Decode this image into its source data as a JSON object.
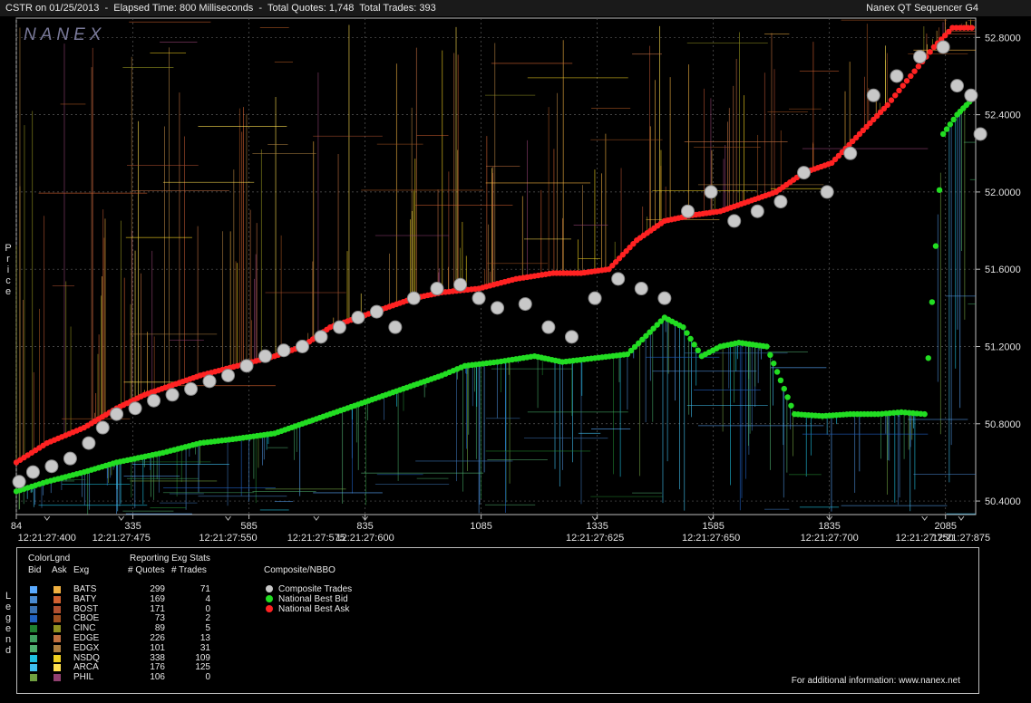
{
  "header": {
    "left": "CSTR on 01/25/2013  -  Elapsed Time: 800 Milliseconds  -  Total Quotes: 1,748  Total Trades: 393",
    "right": "Nanex QT Sequencer G4"
  },
  "logo": "NANEX",
  "axis": {
    "ylabel": "Price",
    "legend_side": "Legend"
  },
  "chart_data": {
    "type": "scatter",
    "title": "",
    "ylabel": "Price",
    "ylim": [
      50.33,
      52.9
    ],
    "xlim": [
      84,
      2150
    ],
    "y_ticks": [
      "52.8000",
      "52.4000",
      "52.0000",
      "51.6000",
      "51.2000",
      "50.8000",
      "50.4000"
    ],
    "y_tick_values": [
      52.8,
      52.4,
      52.0,
      51.6,
      51.2,
      50.8,
      50.4
    ],
    "x_ticks": [
      "84",
      "335",
      "585",
      "835",
      "1085",
      "1335",
      "1585",
      "1835",
      "2085"
    ],
    "x_tick_values": [
      84,
      335,
      585,
      835,
      1085,
      1335,
      1585,
      1835,
      2085
    ],
    "time_labels": [
      "12:21:27:400",
      "12:21:27:475",
      "12:21:27:550",
      "12:21:27:575",
      "12:21:27:600",
      "12:21:27:625",
      "12:21:27:650",
      "12:21:27:700",
      "12:21:27:750",
      "12:21:27:875"
    ],
    "time_label_values": [
      150,
      310,
      540,
      730,
      835,
      1330,
      1580,
      1835,
      2040,
      2180
    ],
    "series": [
      {
        "name": "National Best Bid",
        "color": "#22dd22",
        "points": [
          [
            84,
            50.45
          ],
          [
            150,
            50.5
          ],
          [
            230,
            50.55
          ],
          [
            300,
            50.6
          ],
          [
            400,
            50.65
          ],
          [
            480,
            50.7
          ],
          [
            550,
            50.72
          ],
          [
            640,
            50.75
          ],
          [
            700,
            50.8
          ],
          [
            760,
            50.85
          ],
          [
            820,
            50.9
          ],
          [
            880,
            50.95
          ],
          [
            940,
            51.0
          ],
          [
            1000,
            51.05
          ],
          [
            1050,
            51.1
          ],
          [
            1120,
            51.12
          ],
          [
            1200,
            51.15
          ],
          [
            1260,
            51.12
          ],
          [
            1330,
            51.14
          ],
          [
            1400,
            51.16
          ],
          [
            1480,
            51.35
          ],
          [
            1520,
            51.3
          ],
          [
            1560,
            51.15
          ],
          [
            1600,
            51.2
          ],
          [
            1640,
            51.22
          ],
          [
            1700,
            51.2
          ],
          [
            1760,
            50.85
          ],
          [
            1820,
            50.84
          ],
          [
            1880,
            50.85
          ],
          [
            1940,
            50.85
          ],
          [
            1990,
            50.86
          ],
          [
            2040,
            50.85
          ],
          [
            2080,
            52.3
          ],
          [
            2110,
            52.4
          ],
          [
            2130,
            52.45
          ],
          [
            2150,
            52.5
          ]
        ]
      },
      {
        "name": "National Best Ask",
        "color": "#ff2222",
        "points": [
          [
            84,
            50.6
          ],
          [
            150,
            50.7
          ],
          [
            230,
            50.78
          ],
          [
            300,
            50.88
          ],
          [
            360,
            50.95
          ],
          [
            420,
            51.0
          ],
          [
            480,
            51.05
          ],
          [
            560,
            51.1
          ],
          [
            640,
            51.15
          ],
          [
            700,
            51.2
          ],
          [
            760,
            51.3
          ],
          [
            820,
            51.35
          ],
          [
            880,
            51.4
          ],
          [
            940,
            51.45
          ],
          [
            1000,
            51.48
          ],
          [
            1080,
            51.5
          ],
          [
            1160,
            51.55
          ],
          [
            1240,
            51.58
          ],
          [
            1300,
            51.58
          ],
          [
            1360,
            51.6
          ],
          [
            1420,
            51.75
          ],
          [
            1480,
            51.85
          ],
          [
            1540,
            51.88
          ],
          [
            1600,
            51.9
          ],
          [
            1660,
            51.95
          ],
          [
            1720,
            52.0
          ],
          [
            1780,
            52.1
          ],
          [
            1840,
            52.15
          ],
          [
            1900,
            52.3
          ],
          [
            1960,
            52.45
          ],
          [
            2010,
            52.6
          ],
          [
            2060,
            52.75
          ],
          [
            2100,
            52.85
          ],
          [
            2150,
            52.85
          ]
        ]
      },
      {
        "name": "Composite Trades",
        "color": "#c8c8c8",
        "points": [
          [
            90,
            50.5
          ],
          [
            120,
            50.55
          ],
          [
            160,
            50.58
          ],
          [
            200,
            50.62
          ],
          [
            240,
            50.7
          ],
          [
            270,
            50.78
          ],
          [
            300,
            50.85
          ],
          [
            340,
            50.88
          ],
          [
            380,
            50.92
          ],
          [
            420,
            50.95
          ],
          [
            460,
            50.98
          ],
          [
            500,
            51.02
          ],
          [
            540,
            51.05
          ],
          [
            580,
            51.1
          ],
          [
            620,
            51.15
          ],
          [
            660,
            51.18
          ],
          [
            700,
            51.2
          ],
          [
            740,
            51.25
          ],
          [
            780,
            51.3
          ],
          [
            820,
            51.35
          ],
          [
            860,
            51.38
          ],
          [
            900,
            51.3
          ],
          [
            940,
            51.45
          ],
          [
            990,
            51.5
          ],
          [
            1040,
            51.52
          ],
          [
            1080,
            51.45
          ],
          [
            1120,
            51.4
          ],
          [
            1180,
            51.42
          ],
          [
            1230,
            51.3
          ],
          [
            1280,
            51.25
          ],
          [
            1330,
            51.45
          ],
          [
            1380,
            51.55
          ],
          [
            1430,
            51.5
          ],
          [
            1480,
            51.45
          ],
          [
            1530,
            51.9
          ],
          [
            1580,
            52.0
          ],
          [
            1630,
            51.85
          ],
          [
            1680,
            51.9
          ],
          [
            1730,
            51.95
          ],
          [
            1780,
            52.1
          ],
          [
            1830,
            52.0
          ],
          [
            1880,
            52.2
          ],
          [
            1930,
            52.5
          ],
          [
            1980,
            52.6
          ],
          [
            2030,
            52.7
          ],
          [
            2080,
            52.75
          ],
          [
            2110,
            52.55
          ],
          [
            2140,
            52.5
          ],
          [
            2160,
            52.3
          ]
        ]
      }
    ]
  },
  "legend": {
    "title_color": "ColorLgnd",
    "col_bid": "Bid",
    "col_ask": "Ask",
    "col_exg": "Exg",
    "stats_title": "Reporting Exg Stats",
    "col_quotes": "# Quotes",
    "col_trades": "# Trades",
    "composite_title": "Composite/NBBO",
    "exchanges": [
      {
        "exg": "BATS",
        "quotes": "299",
        "trades": "71",
        "bid": "#5aaaff",
        "ask": "#f0b040"
      },
      {
        "exg": "BATY",
        "quotes": "169",
        "trades": "4",
        "bid": "#4a8ad0",
        "ask": "#d06030"
      },
      {
        "exg": "BOST",
        "quotes": "171",
        "trades": "0",
        "bid": "#3a70b0",
        "ask": "#b05030"
      },
      {
        "exg": "CBOE",
        "quotes": "73",
        "trades": "2",
        "bid": "#2060c0",
        "ask": "#a05020"
      },
      {
        "exg": "CINC",
        "quotes": "89",
        "trades": "5",
        "bid": "#208030",
        "ask": "#909020"
      },
      {
        "exg": "EDGE",
        "quotes": "226",
        "trades": "13",
        "bid": "#40a060",
        "ask": "#c07040"
      },
      {
        "exg": "EDGX",
        "quotes": "101",
        "trades": "31",
        "bid": "#50b070",
        "ask": "#b08040"
      },
      {
        "exg": "NSDQ",
        "quotes": "338",
        "trades": "109",
        "bid": "#20c0e0",
        "ask": "#f0d020"
      },
      {
        "exg": "ARCA",
        "quotes": "176",
        "trades": "125",
        "bid": "#40c0f0",
        "ask": "#ffe050"
      },
      {
        "exg": "PHIL",
        "quotes": "106",
        "trades": "0",
        "bid": "#70a040",
        "ask": "#904070"
      }
    ],
    "composite": [
      {
        "label": "Composite Trades",
        "color": "#c8c8c8"
      },
      {
        "label": "National Best Bid",
        "color": "#22dd22"
      },
      {
        "label": "National Best Ask",
        "color": "#ff2222"
      }
    ],
    "footer": "For additional information: www.nanex.net"
  }
}
